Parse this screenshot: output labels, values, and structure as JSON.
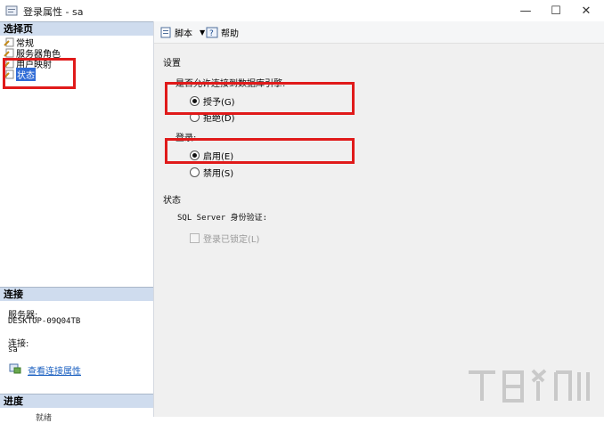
{
  "window": {
    "title": "登录属性 - sa",
    "minimize": "—",
    "maximize": "☐",
    "close": "✕"
  },
  "sidebar": {
    "select_page_header": "选择页",
    "pages": [
      {
        "label": "常规",
        "icon": "page-wrench-icon",
        "selected": false
      },
      {
        "label": "服务器角色",
        "icon": "page-wrench-icon",
        "selected": false
      },
      {
        "label": "用户映射",
        "icon": "page-wrench-icon",
        "selected": false
      },
      {
        "label": "状态",
        "icon": "page-wrench-icon",
        "selected": true
      }
    ],
    "connection_header": "连接",
    "server_label": "服务器:",
    "server_value": "DESKTOP-09Q04TB",
    "connection_label": "连接:",
    "connection_value": "sa",
    "view_connection_props": "查看连接属性",
    "progress_header": "进度",
    "progress_status": "就绪"
  },
  "toolbar": {
    "script_label": "脚本",
    "help_label": "帮助"
  },
  "settings": {
    "section_title": "设置",
    "db_engine_question": "是否允许连接到数据库引擎:",
    "grant_label": "授予(G)",
    "deny_label": "拒绝(D)",
    "login_label": "登录:",
    "enabled_label": "启用(E)",
    "disabled_label": "禁用(S)",
    "status_title": "状态",
    "sql_auth_label": "SQL Server 身份验证:",
    "locked_out_label": "登录已锁定(L)"
  },
  "colors": {
    "highlight": "#e01a1a",
    "selected": "#2f6bd6",
    "link": "#1a5fc0"
  }
}
